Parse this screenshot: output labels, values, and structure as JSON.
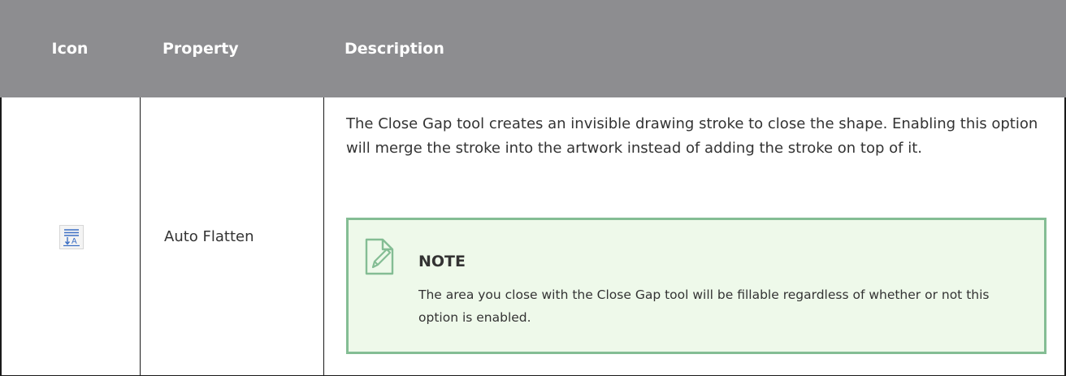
{
  "table": {
    "headers": {
      "icon": "Icon",
      "property": "Property",
      "description": "Description"
    },
    "rows": [
      {
        "icon": "auto-flatten-icon",
        "icon_glyph": "A",
        "property": "Auto Flatten",
        "description": "The Close Gap tool creates an invisible drawing stroke to close the shape. Enabling this option will merge the stroke into the artwork instead of adding the stroke on top of it.",
        "note": {
          "icon": "note-pencil-icon",
          "title": "NOTE",
          "text": "The area you close with the Close Gap tool will be fillable regardless of whether or not this option is enabled."
        }
      }
    ]
  },
  "colors": {
    "header_bg": "#8d8d90",
    "note_bg": "#eef9ea",
    "note_border": "#84bd94",
    "icon_accent": "#3d6fc4"
  }
}
